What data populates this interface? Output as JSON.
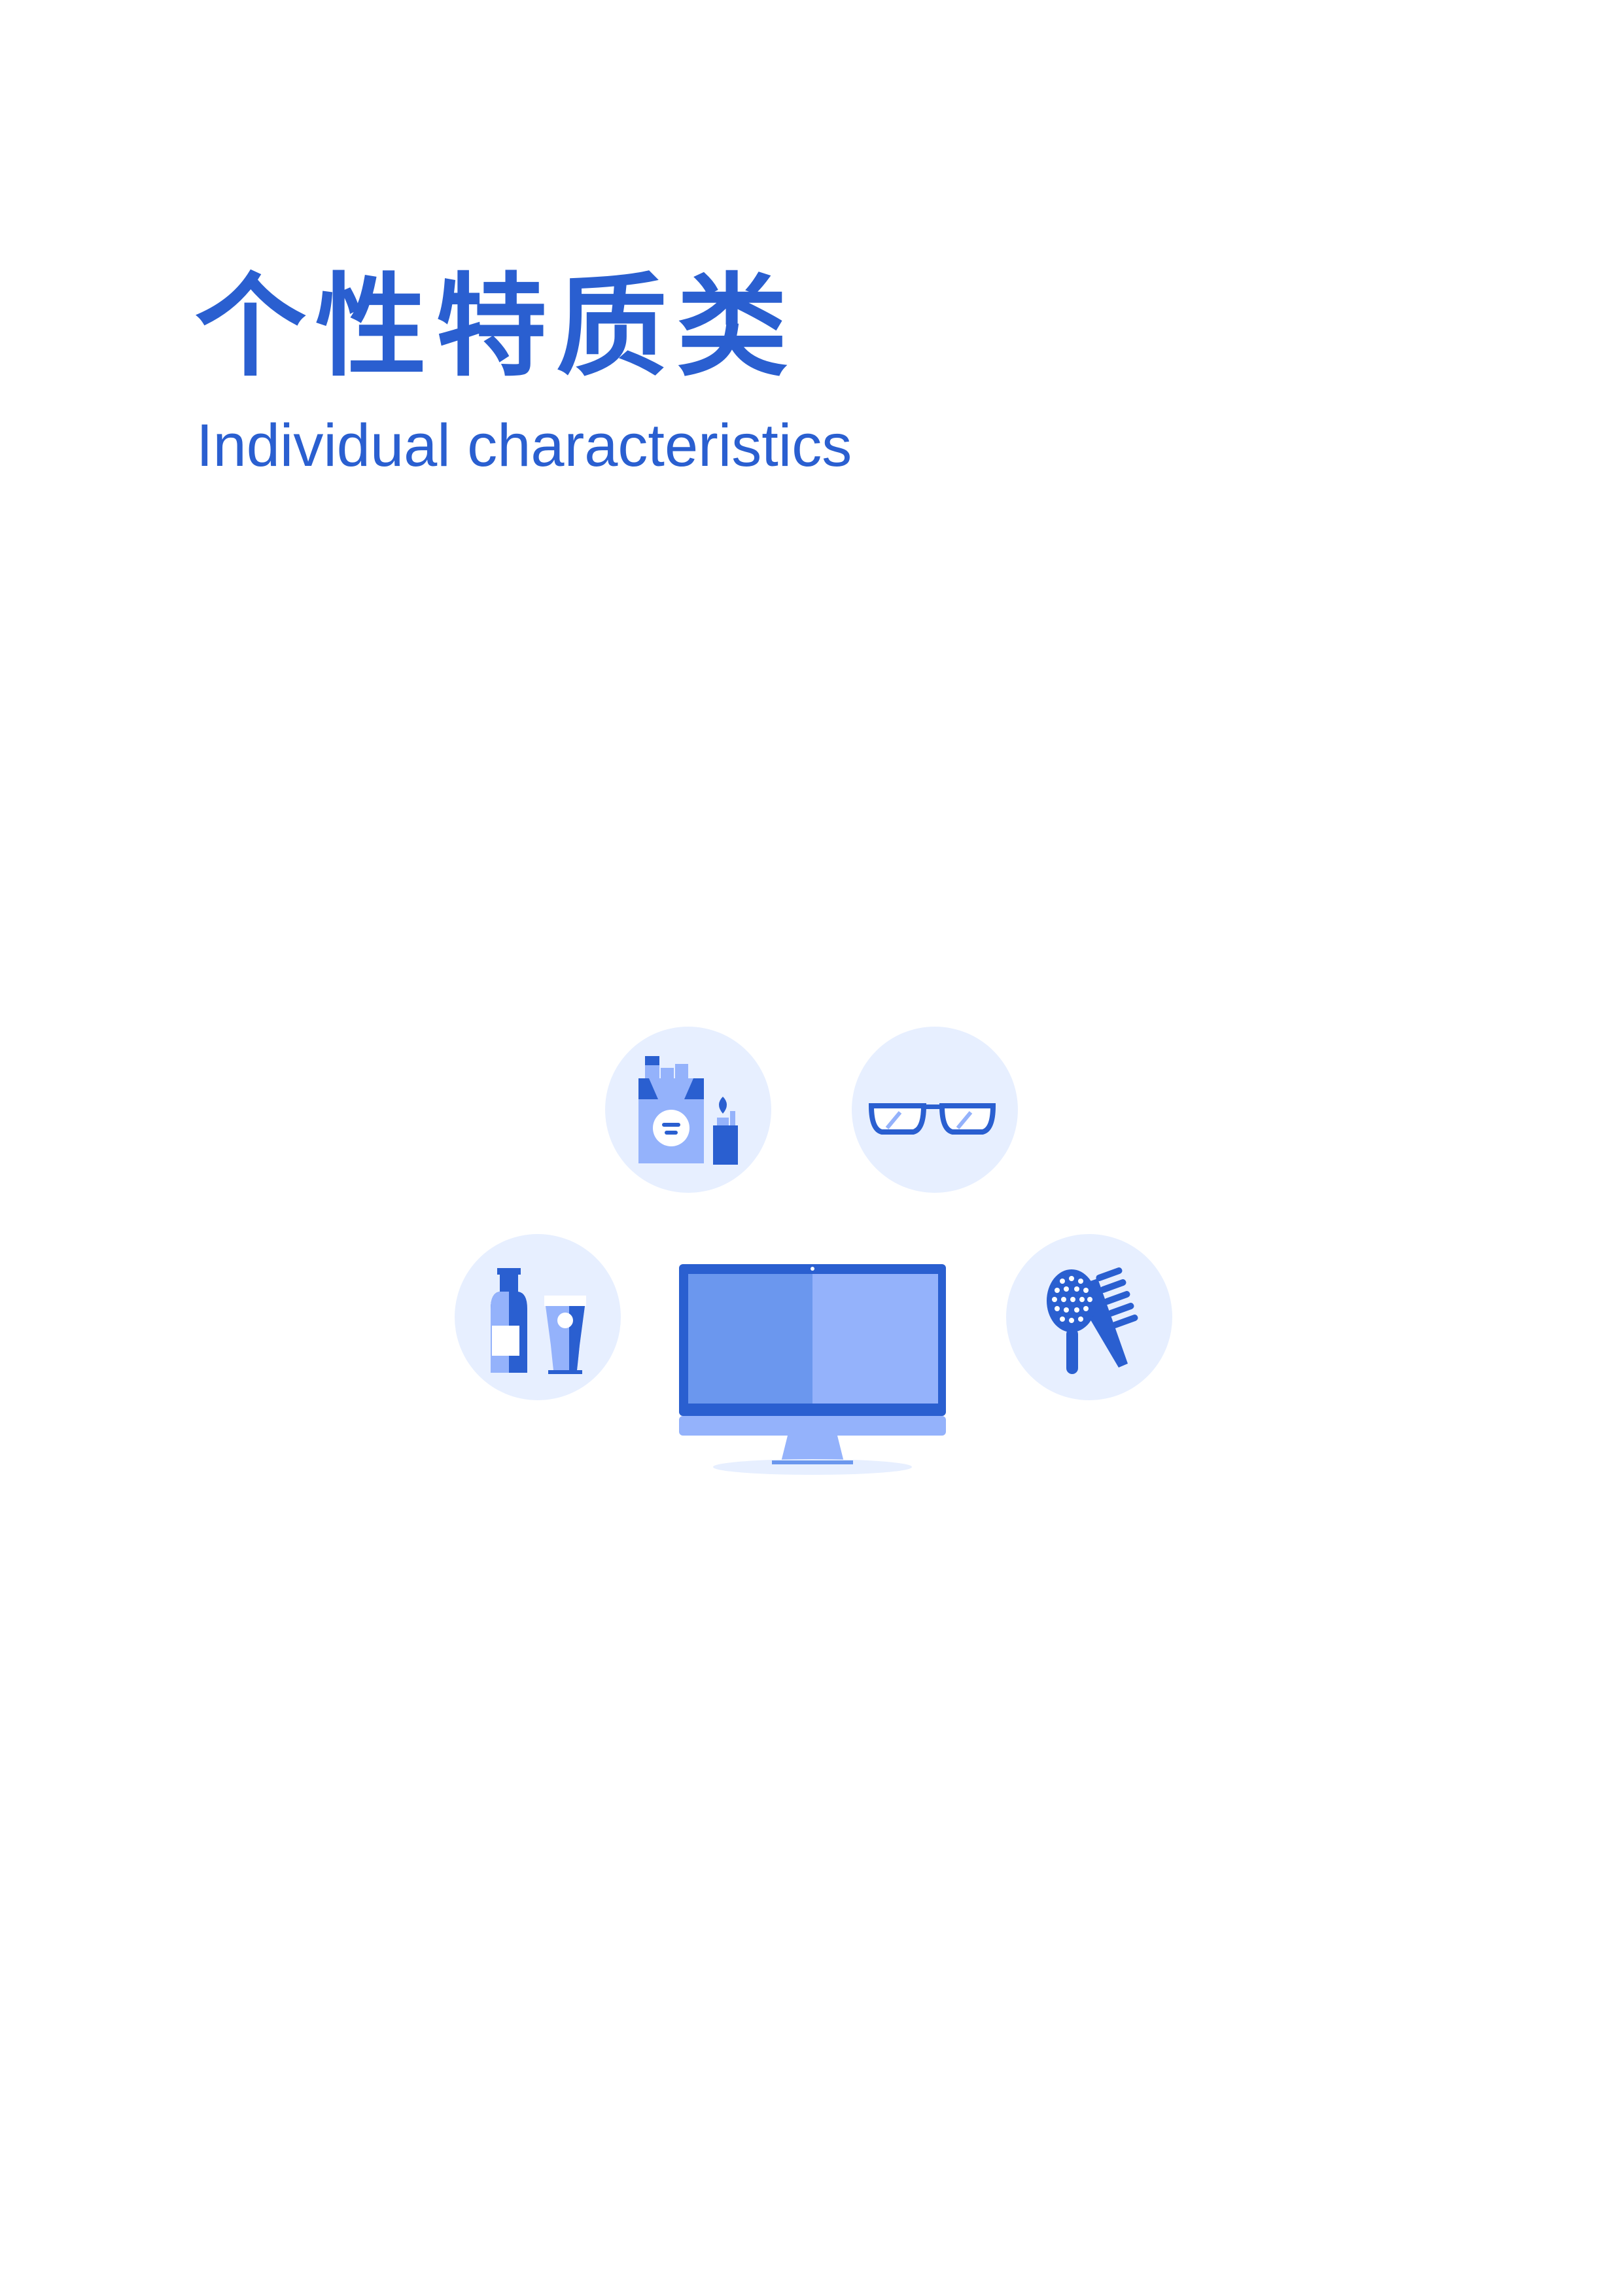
{
  "header": {
    "title_zh": "个性特质类",
    "title_en": "Individual characteristics"
  },
  "illustration": {
    "items": [
      "cigarettes-lighter-icon",
      "glasses-icon",
      "bottle-beer-icon",
      "computer-monitor-icon",
      "comb-brush-icon"
    ]
  },
  "colors": {
    "primary": "#2a5fd0",
    "light": "#94b2fb",
    "mid": "#6b97ee",
    "circle_bg": "#e7efff",
    "bg": "#ffffff"
  }
}
